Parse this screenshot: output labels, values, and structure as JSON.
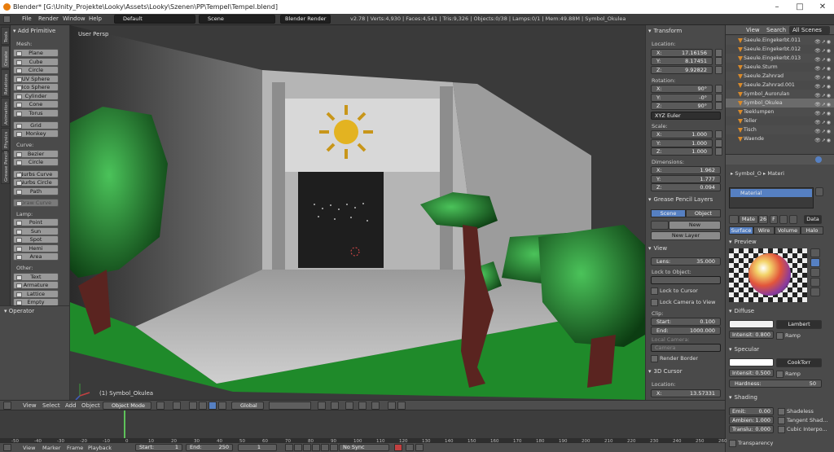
{
  "title": "Blender* [G:\\Unity_Projekte\\Looky\\Assets\\Looky\\Szenen\\PP\\Tempel\\Tempel.blend]",
  "menu": [
    "File",
    "Render",
    "Window",
    "Help"
  ],
  "layout": "Default",
  "scene": "Scene",
  "engine": "Blender Render",
  "stats": "v2.78 | Verts:4,930 | Faces:4,541 | Tris:9,326 | Objects:0/38 | Lamps:0/1 | Mem:49.88M | Symbol_Okulea",
  "toolshelf": {
    "tabs": [
      "Tools",
      "Create",
      "Relations",
      "Animation",
      "Physics",
      "Grease Pencil"
    ],
    "header": "Add Primitive",
    "mesh_label": "Mesh:",
    "mesh": [
      "Plane",
      "Cube",
      "Circle",
      "UV Sphere",
      "Ico Sphere",
      "Cylinder",
      "Cone",
      "Torus"
    ],
    "mesh2": [
      "Grid",
      "Monkey"
    ],
    "curve_label": "Curve:",
    "curve": [
      "Bezier",
      "Circle"
    ],
    "curve2": [
      "Nurbs Curve",
      "Nurbs Circle",
      "Path"
    ],
    "draw_curve": "Draw Curve",
    "lamp_label": "Lamp:",
    "lamp": [
      "Point",
      "Sun",
      "Spot",
      "Hemi",
      "Area"
    ],
    "other_label": "Other:",
    "other": [
      "Text",
      "Armature",
      "Lattice",
      "Empty"
    ]
  },
  "operator": "Operator",
  "viewport": {
    "label": "User Persp",
    "object": "(1) Symbol_Okulea"
  },
  "npanel": {
    "transform": "Transform",
    "location": "Location:",
    "loc": [
      [
        "X:",
        "17.16156"
      ],
      [
        "Y:",
        "8.17451"
      ],
      [
        "Z:",
        "9.92822"
      ]
    ],
    "rotation": "Rotation:",
    "rot": [
      [
        "X:",
        "90°"
      ],
      [
        "Y:",
        "-0°"
      ],
      [
        "Z:",
        "90°"
      ]
    ],
    "euler": "XYZ Euler",
    "scale_label": "Scale:",
    "scale": [
      [
        "X:",
        "1.000"
      ],
      [
        "Y:",
        "1.000"
      ],
      [
        "Z:",
        "1.000"
      ]
    ],
    "dimensions": "Dimensions:",
    "dims": [
      [
        "X:",
        "1.962"
      ],
      [
        "Y:",
        "1.777"
      ],
      [
        "Z:",
        "0.094"
      ]
    ],
    "grease": "Grease Pencil Layers",
    "gp_scene": "Scene",
    "gp_object": "Object",
    "gp_new": "New",
    "gp_newlayer": "New Layer",
    "view": "View",
    "lens": [
      "Lens:",
      "35.000"
    ],
    "lock_obj": "Lock to Object:",
    "lock_cursor": "Lock to Cursor",
    "lock_camera": "Lock Camera to View",
    "clip": "Clip:",
    "clip_start": [
      "Start:",
      "0.100"
    ],
    "clip_end": [
      "End:",
      "1000.000"
    ],
    "local_camera": "Local Camera:",
    "camera": "Camera",
    "render_border": "Render Border",
    "cursor": "3D Cursor",
    "cursor_loc": "Location:",
    "cursor_x": [
      "X:",
      "13.57331"
    ]
  },
  "outliner": {
    "view": "View",
    "search": "Search",
    "filter": "All Scenes",
    "rows": [
      "Saeule.Eingekerbt.011",
      "Saeule.Eingekerbt.012",
      "Saeule.Eingekerbt.013",
      "Saeule.Sturm",
      "Saeule.Zahnrad",
      "Saeule.Zahnrad.001",
      "Symbol_Aurorulan",
      "Symbol_Okulea",
      "Teeklumpen",
      "Teller",
      "Tisch",
      "Waende"
    ]
  },
  "properties": {
    "crumb": [
      "Symbol_O",
      "Materi"
    ],
    "material": "Material",
    "mat_field": "Mate",
    "users": "26",
    "f": "F",
    "data": "Data",
    "tabs": [
      "Surface",
      "Wire",
      "Volume",
      "Halo"
    ],
    "preview": "Preview",
    "diffuse": "Diffuse",
    "lambert": "Lambert",
    "intensity_d": [
      "Intensit:",
      "0.800"
    ],
    "ramp": "Ramp",
    "specular": "Specular",
    "cooktorr": "CookTorr",
    "intensity_s": [
      "Intensit:",
      "0.500"
    ],
    "hardness": [
      "Hardness:",
      "50"
    ],
    "shading": "Shading",
    "emit": [
      "Emit:",
      "0.00"
    ],
    "ambient": [
      "Ambien:",
      "1.000"
    ],
    "translu": [
      "Translu:",
      "0.000"
    ],
    "shadeless": "Shadeless",
    "tangent": "Tangent Shad...",
    "cubic": "Cubic Interpo...",
    "transparency": "Transparency"
  },
  "v3dheader": {
    "menus": [
      "View",
      "Select",
      "Add",
      "Object"
    ],
    "mode": "Object Mode",
    "orient": "Global"
  },
  "timeline": {
    "ticks": [
      "-50",
      "-40",
      "-30",
      "-20",
      "-10",
      "0",
      "10",
      "20",
      "30",
      "40",
      "50",
      "60",
      "70",
      "80",
      "90",
      "100",
      "110",
      "120",
      "130",
      "140",
      "150",
      "160",
      "170",
      "180",
      "190",
      "200",
      "210",
      "220",
      "230",
      "240",
      "250",
      "260"
    ],
    "menus": [
      "View",
      "Marker",
      "Frame",
      "Playback"
    ],
    "start": [
      "Start:",
      "1"
    ],
    "end": [
      "End:",
      "250"
    ],
    "current": "1",
    "sync": "No Sync"
  }
}
